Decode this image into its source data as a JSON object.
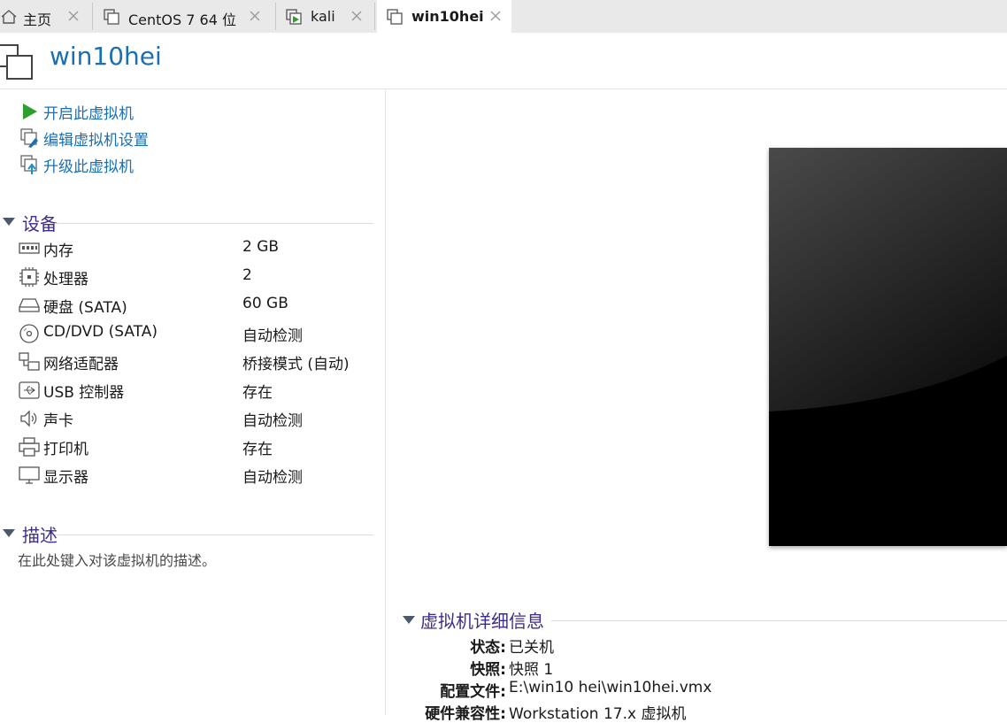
{
  "tabs": [
    {
      "label": "主页",
      "icon": "home-icon"
    },
    {
      "label": "CentOS 7 64 位",
      "icon": "vm-icon"
    },
    {
      "label": "kali",
      "icon": "vm-running-icon"
    },
    {
      "label": "win10hei",
      "icon": "vm-icon",
      "active": true
    }
  ],
  "header": {
    "title": "win10hei"
  },
  "actions": [
    {
      "label": "开启此虚拟机",
      "icon": "play-icon"
    },
    {
      "label": "编辑虚拟机设置",
      "icon": "edit-settings-icon"
    },
    {
      "label": "升级此虚拟机",
      "icon": "upgrade-icon"
    }
  ],
  "devices": {
    "title": "设备",
    "items": [
      {
        "name": "内存",
        "value": "2 GB",
        "icon": "memory-icon"
      },
      {
        "name": "处理器",
        "value": "2",
        "icon": "cpu-icon"
      },
      {
        "name": "硬盘 (SATA)",
        "value": "60 GB",
        "icon": "harddisk-icon"
      },
      {
        "name": "CD/DVD (SATA)",
        "value": "自动检测",
        "icon": "cd-icon"
      },
      {
        "name": "网络适配器",
        "value": "桥接模式 (自动)",
        "icon": "network-icon"
      },
      {
        "name": "USB 控制器",
        "value": "存在",
        "icon": "usb-icon"
      },
      {
        "name": "声卡",
        "value": "自动检测",
        "icon": "sound-icon"
      },
      {
        "name": "打印机",
        "value": "存在",
        "icon": "printer-icon"
      },
      {
        "name": "显示器",
        "value": "自动检测",
        "icon": "display-icon"
      }
    ]
  },
  "description": {
    "title": "描述",
    "placeholder": "在此处键入对该虚拟机的描述。"
  },
  "details": {
    "title": "虚拟机详细信息",
    "rows": [
      {
        "key": "状态:",
        "value": "已关机"
      },
      {
        "key": "快照:",
        "value": "快照 1"
      },
      {
        "key": "配置文件:",
        "value": "E:\\win10 hei\\win10hei.vmx"
      },
      {
        "key": "硬件兼容性:",
        "value": "Workstation 17.x 虚拟机"
      }
    ]
  },
  "colors": {
    "link": "#1a6fb3",
    "section": "#3a2e8c",
    "play": "#2e9e2e"
  }
}
